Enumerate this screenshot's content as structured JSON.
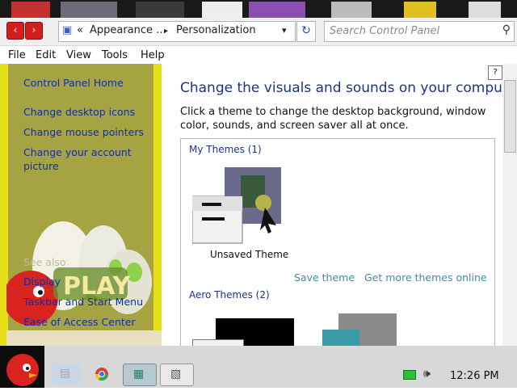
{
  "address_bar": {
    "back_glyph": "‹",
    "forward_glyph": "›",
    "breadcrumb_chevron": "«",
    "crumb_1": "Appearance ...",
    "crumb_sep": "▸",
    "crumb_2": "Personalization",
    "dropdown_glyph": "▾",
    "refresh_glyph": "↻",
    "search_placeholder": "Search Control Panel",
    "search_glyph": "⚲"
  },
  "menu": [
    "File",
    "Edit",
    "View",
    "Tools",
    "Help"
  ],
  "left_pane": {
    "home_link": "Control Panel Home",
    "tasks": [
      "Change desktop icons",
      "Change mouse pointers",
      "Change your account picture"
    ],
    "see_also_heading": "See also",
    "see_also_links": [
      "Display",
      "Taskbar and Start Menu",
      "Ease of Access Center"
    ],
    "art_text": "PLAY"
  },
  "main": {
    "title": "Change the visuals and sounds on your computer",
    "description": "Click a theme to change the desktop background, window color, sounds, and screen saver all at once.",
    "my_themes_heading": "My Themes (1)",
    "theme_name": "Unsaved Theme",
    "save_theme": "Save theme",
    "get_more": "Get more themes online",
    "aero_heading": "Aero Themes (2)"
  },
  "taskbar": {
    "time": "12:26 PM"
  },
  "colors": {
    "left_pane_bg": "#a6a343",
    "link_blue": "#0b2fb0",
    "title_blue": "#1e3287",
    "nav_red": "#d21e1e"
  }
}
